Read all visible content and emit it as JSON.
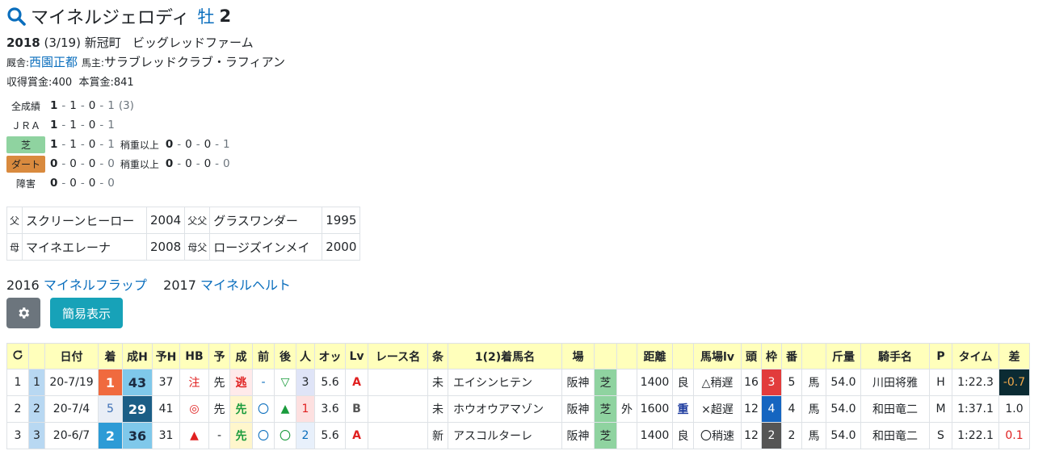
{
  "horse": {
    "name": "マイネルジェロディ",
    "sex": "牡",
    "age": "2"
  },
  "birth": {
    "year": "2018",
    "date": "(3/19)",
    "place": "新冠町",
    "breeder": "ビッグレッドファーム"
  },
  "stable": {
    "label": "厩舎:",
    "trainer": "西園正都",
    "owner_label": "馬主:",
    "owner": "サラブレッドクラブ・ラフィアン"
  },
  "prize": {
    "earned_label": "収得賞金:",
    "earned": "400",
    "main_label": "本賞金:",
    "main": "841"
  },
  "records": {
    "all": {
      "label": "全成績",
      "values": [
        "1",
        "1",
        "0",
        "1"
      ],
      "extra": "(3)"
    },
    "jra": {
      "label": "ＪＲＡ",
      "values": [
        "1",
        "1",
        "0",
        "1"
      ]
    },
    "turf": {
      "label": "芝",
      "values": [
        "1",
        "1",
        "0",
        "1"
      ],
      "sub_label": "稍重以上",
      "sub_values": [
        "0",
        "0",
        "0",
        "1"
      ]
    },
    "dirt": {
      "label": "ダート",
      "values": [
        "0",
        "0",
        "0",
        "0"
      ],
      "sub_label": "稍重以上",
      "sub_values": [
        "0",
        "0",
        "0",
        "0"
      ]
    },
    "jump": {
      "label": "障害",
      "values": [
        "0",
        "0",
        "0",
        "0"
      ]
    }
  },
  "pedigree": {
    "sire_label": "父",
    "sire": "スクリーンヒーロー",
    "sire_year": "2004",
    "sire_sire_label": "父父",
    "sire_sire": "グラスワンダー",
    "sire_sire_year": "1995",
    "dam_label": "母",
    "dam": "マイネエレーナ",
    "dam_year": "2008",
    "dam_sire_label": "母父",
    "dam_sire": "ロージズインメイ",
    "dam_sire_year": "2000"
  },
  "siblings": [
    {
      "year": "2016",
      "name": "マイネルフラップ"
    },
    {
      "year": "2017",
      "name": "マイネルヘルト"
    }
  ],
  "buttons": {
    "settings": "gear-icon",
    "simple": "簡易表示"
  },
  "table": {
    "headers": [
      "",
      "",
      "日付",
      "着",
      "成H",
      "予H",
      "HB",
      "予",
      "成",
      "前",
      "後",
      "人",
      "オッ",
      "Lv",
      "レース名",
      "条",
      "1(2)着馬名",
      "場",
      "",
      "",
      "距離",
      "",
      "馬場lv",
      "頭",
      "枠",
      "番",
      "",
      "斤量",
      "騎手名",
      "P",
      "タイム",
      "差"
    ],
    "rows": [
      {
        "no": "1",
        "no2": "1",
        "date": "20-7/19",
        "rank": "1",
        "seiH": "43",
        "yoH": "37",
        "hb": "注",
        "yo": "先",
        "sei": "逃",
        "mae": "-",
        "ato": "▽",
        "pop": "3",
        "odds": "5.6",
        "lv": "A",
        "race": "",
        "cond": "未",
        "winner": "エイシンヒテン",
        "place": "阪神",
        "surface": "芝",
        "inout": "",
        "dist": "1400",
        "going": "良",
        "baba": "△稍遅",
        "heads": "16",
        "waku": "3",
        "ban": "5",
        "uma": "馬",
        "kin": "54.0",
        "jockey": "川田将雅",
        "p": "H",
        "time": "1:22.3",
        "diff": "-0.7"
      },
      {
        "no": "2",
        "no2": "2",
        "date": "20-7/4",
        "rank": "5",
        "seiH": "29",
        "yoH": "41",
        "hb": "◎",
        "yo": "先",
        "sei": "先",
        "mae": "〇",
        "ato": "▲",
        "pop": "1",
        "odds": "3.6",
        "lv": "B",
        "race": "",
        "cond": "未",
        "winner": "ホウオウアマゾン",
        "place": "阪神",
        "surface": "芝",
        "inout": "外",
        "dist": "1600",
        "going": "重",
        "baba": "×超遅",
        "heads": "12",
        "waku": "4",
        "ban": "4",
        "uma": "馬",
        "kin": "54.0",
        "jockey": "和田竜二",
        "p": "M",
        "time": "1:37.1",
        "diff": "1.0"
      },
      {
        "no": "3",
        "no2": "3",
        "date": "20-6/7",
        "rank": "2",
        "seiH": "36",
        "yoH": "31",
        "hb": "▲",
        "yo": "-",
        "sei": "先",
        "mae": "〇",
        "ato": "〇",
        "pop": "2",
        "odds": "5.6",
        "lv": "A",
        "race": "",
        "cond": "新",
        "winner": "アスコルターレ",
        "place": "阪神",
        "surface": "芝",
        "inout": "",
        "dist": "1400",
        "going": "良",
        "baba": "〇稍速",
        "heads": "12",
        "waku": "2",
        "ban": "2",
        "uma": "馬",
        "kin": "54.0",
        "jockey": "和田竜二",
        "p": "S",
        "time": "1:22.1",
        "diff": "0.1"
      }
    ]
  },
  "colors": {
    "link": "#0a6ebd",
    "header_bg": "#ffffbb",
    "turf": "#8fd3a0",
    "dirt": "#d98a3e"
  }
}
